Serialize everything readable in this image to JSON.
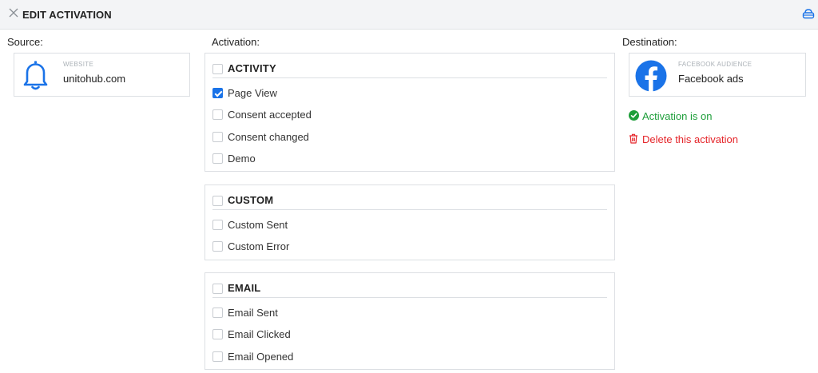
{
  "header": {
    "title": "EDIT ACTIVATION",
    "close_icon": "close-icon",
    "save_icon": "save-icon",
    "accent": "#1a73e8"
  },
  "source": {
    "label": "Source:",
    "type_caption": "WEBSITE",
    "name": "unitohub.com",
    "icon": "bell-icon"
  },
  "activation": {
    "label": "Activation:",
    "groups": [
      {
        "title": "ACTIVITY",
        "checked": false,
        "items": [
          {
            "label": "Page View",
            "checked": true
          },
          {
            "label": "Consent accepted",
            "checked": false
          },
          {
            "label": "Consent changed",
            "checked": false
          },
          {
            "label": "Demo",
            "checked": false
          }
        ]
      },
      {
        "title": "CUSTOM",
        "checked": false,
        "items": [
          {
            "label": "Custom Sent",
            "checked": false
          },
          {
            "label": "Custom Error",
            "checked": false
          }
        ]
      },
      {
        "title": "EMAIL",
        "checked": false,
        "items": [
          {
            "label": "Email Sent",
            "checked": false
          },
          {
            "label": "Email Clicked",
            "checked": false
          },
          {
            "label": "Email Opened",
            "checked": false
          }
        ]
      }
    ]
  },
  "destination": {
    "label": "Destination:",
    "type_caption": "FACEBOOK AUDIENCE",
    "name": "Facebook ads",
    "icon": "facebook-icon",
    "status_text": "Activation is on",
    "status_color": "#1e9e3a",
    "delete_text": "Delete this activation",
    "delete_color": "#e5252a"
  }
}
